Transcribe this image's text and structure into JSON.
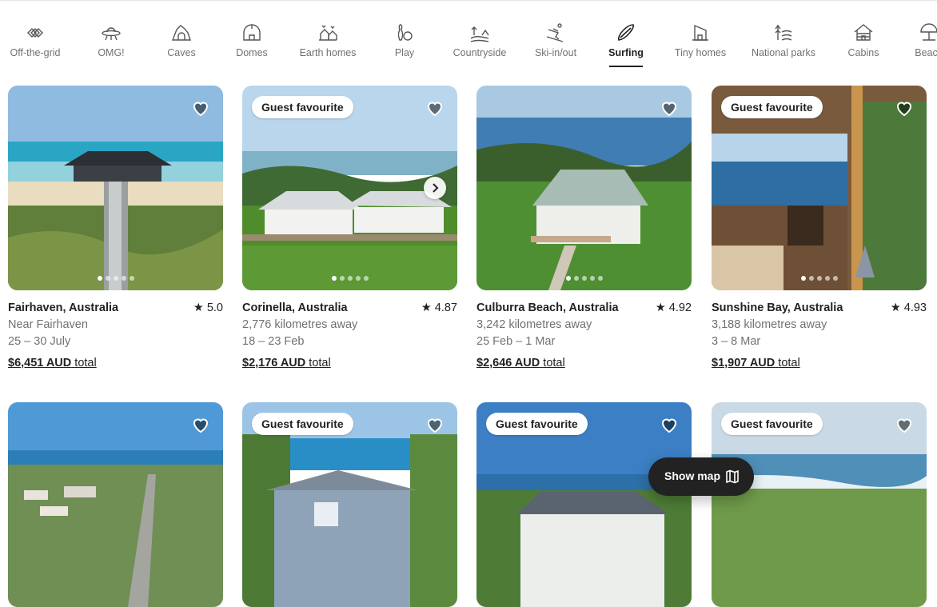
{
  "categories": [
    {
      "label": "Off-the-grid",
      "icon": "diamonds-icon"
    },
    {
      "label": "OMG!",
      "icon": "ufo-icon"
    },
    {
      "label": "Caves",
      "icon": "cave-icon"
    },
    {
      "label": "Domes",
      "icon": "dome-icon"
    },
    {
      "label": "Earth homes",
      "icon": "earth-home-icon"
    },
    {
      "label": "Play",
      "icon": "bowling-icon"
    },
    {
      "label": "Countryside",
      "icon": "countryside-icon"
    },
    {
      "label": "Ski-in/out",
      "icon": "skier-icon"
    },
    {
      "label": "Surfing",
      "icon": "surfboard-icon",
      "active": true
    },
    {
      "label": "Tiny homes",
      "icon": "tiny-home-icon"
    },
    {
      "label": "National parks",
      "icon": "national-park-icon"
    },
    {
      "label": "Cabins",
      "icon": "cabin-icon"
    },
    {
      "label": "Beach",
      "icon": "beach-icon"
    }
  ],
  "listings": [
    {
      "location": "Fairhaven, Australia",
      "rating": "5.0",
      "subtitle": "Near Fairhaven",
      "dates": "25 – 30 July",
      "price": "$6,451 AUD",
      "price_suffix": "total",
      "badge": ""
    },
    {
      "location": "Corinella, Australia",
      "rating": "4.87",
      "subtitle": "2,776 kilometres away",
      "dates": "18 – 23 Feb",
      "price": "$2,176 AUD",
      "price_suffix": "total",
      "badge": "Guest favourite"
    },
    {
      "location": "Culburra Beach, Australia",
      "rating": "4.92",
      "subtitle": "3,242 kilometres away",
      "dates": "25 Feb – 1 Mar",
      "price": "$2,646 AUD",
      "price_suffix": "total",
      "badge": ""
    },
    {
      "location": "Sunshine Bay, Australia",
      "rating": "4.93",
      "subtitle": "3,188 kilometres away",
      "dates": "3 – 8 Mar",
      "price": "$1,907 AUD",
      "price_suffix": "total",
      "badge": "Guest favourite"
    },
    {
      "badge": ""
    },
    {
      "badge": "Guest favourite"
    },
    {
      "badge": "Guest favourite"
    },
    {
      "badge": "Guest favourite"
    }
  ],
  "rating_star": "★",
  "show_map": {
    "label": "Show map",
    "icon": "map-icon"
  }
}
